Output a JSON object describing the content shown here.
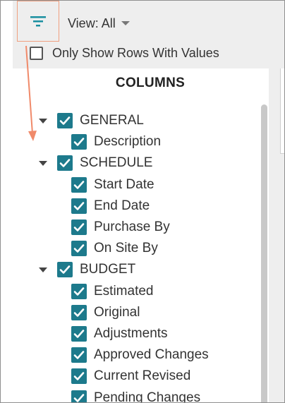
{
  "toolbar": {
    "view_label": "View: All",
    "only_show_label": "Only Show Rows With Values"
  },
  "panel": {
    "title": "COLUMNS",
    "groups": [
      {
        "label": "GENERAL",
        "checked": true,
        "items": [
          {
            "label": "Description",
            "checked": true
          }
        ]
      },
      {
        "label": "SCHEDULE",
        "checked": true,
        "items": [
          {
            "label": "Start Date",
            "checked": true
          },
          {
            "label": "End Date",
            "checked": true
          },
          {
            "label": "Purchase By",
            "checked": true
          },
          {
            "label": "On Site By",
            "checked": true
          }
        ]
      },
      {
        "label": "BUDGET",
        "checked": true,
        "items": [
          {
            "label": "Estimated",
            "checked": true
          },
          {
            "label": "Original",
            "checked": true
          },
          {
            "label": "Adjustments",
            "checked": true
          },
          {
            "label": "Approved Changes",
            "checked": true
          },
          {
            "label": "Current Revised",
            "checked": true
          },
          {
            "label": "Pending Changes",
            "checked": true
          }
        ]
      }
    ]
  },
  "colors": {
    "accent": "#1d7a8c",
    "filter_icon": "#1a8fa0",
    "callout": "#f08a6a",
    "toolbar_bg": "#eeeeee"
  }
}
